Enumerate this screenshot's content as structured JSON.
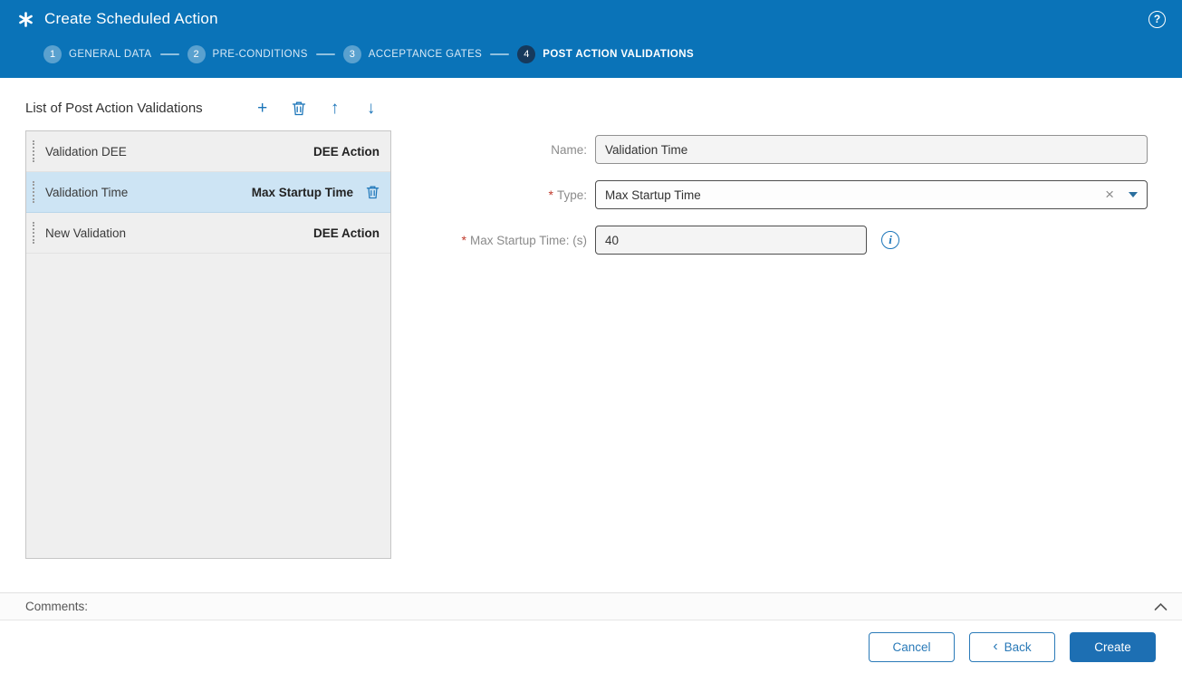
{
  "header": {
    "title": "Create Scheduled Action"
  },
  "icons": {
    "help": "?",
    "add": "+",
    "move_up": "↑",
    "move_down": "↓",
    "clear": "×",
    "back_chevron": "‹",
    "info": "i",
    "required": "*"
  },
  "stepper": {
    "steps": [
      {
        "number": "1",
        "label": "GENERAL DATA"
      },
      {
        "number": "2",
        "label": "PRE-CONDITIONS"
      },
      {
        "number": "3",
        "label": "ACCEPTANCE GATES"
      },
      {
        "number": "4",
        "label": "POST ACTION VALIDATIONS"
      }
    ]
  },
  "list_panel": {
    "title": "List of Post Action Validations",
    "items": [
      {
        "name": "Validation DEE",
        "type": "DEE Action"
      },
      {
        "name": "Validation Time",
        "type": "Max Startup Time"
      },
      {
        "name": "New Validation",
        "type": "DEE Action"
      }
    ]
  },
  "form": {
    "name_label": "Name:",
    "name_value": "Validation Time",
    "type_label": "Type:",
    "type_value": "Max Startup Time",
    "max_label": "Max Startup Time: (s)",
    "max_value": "40"
  },
  "comments": {
    "label": "Comments:"
  },
  "footer": {
    "cancel": "Cancel",
    "back": "Back",
    "create": "Create"
  },
  "colors": {
    "header_blue": "#0a73b8",
    "active_step": "#16395c",
    "selected_row": "#cde4f4",
    "accent_blue": "#1b75b9",
    "required_red": "#c0392b"
  }
}
